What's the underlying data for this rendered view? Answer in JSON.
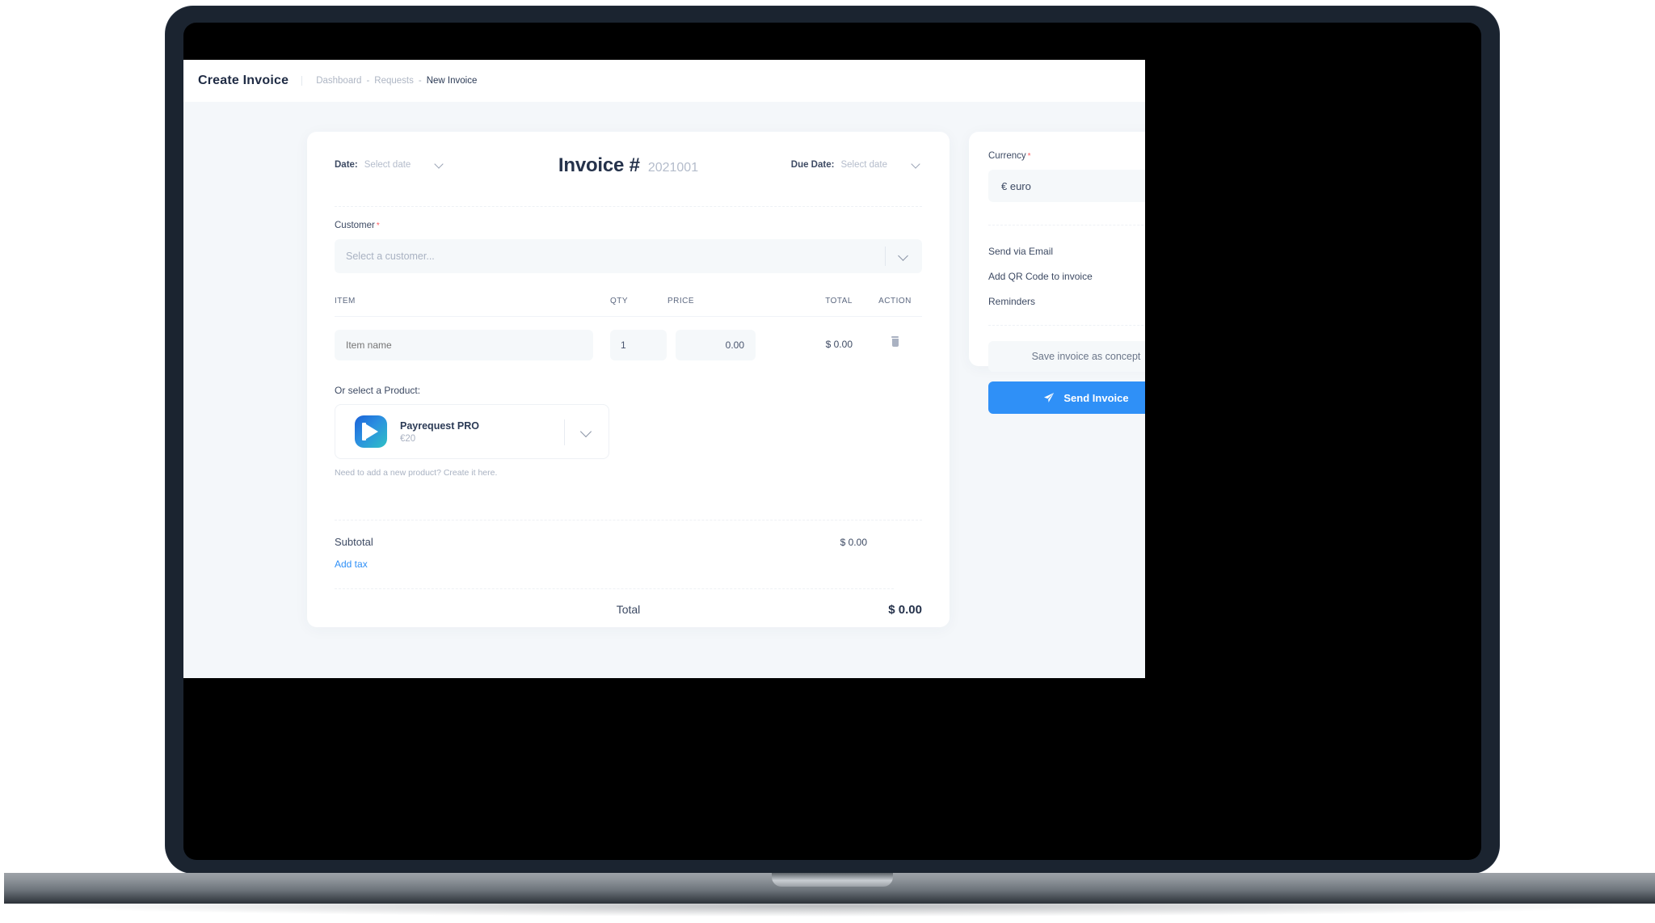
{
  "header": {
    "title": "Create Invoice",
    "breadcrumb": [
      {
        "label": "Dashboard",
        "current": false
      },
      {
        "label": "Requests",
        "current": false
      },
      {
        "label": "New Invoice",
        "current": true
      }
    ],
    "separator": "-"
  },
  "invoice": {
    "date_label": "Date:",
    "date_value": "Select date",
    "due_date_label": "Due Date:",
    "due_date_value": "Select date",
    "number_label": "Invoice #",
    "number_value": "2021001"
  },
  "customer": {
    "label": "Customer",
    "required_mark": "*",
    "placeholder": "Select a customer..."
  },
  "items": {
    "columns": [
      "ITEM",
      "QTY",
      "PRICE",
      "TOTAL",
      "ACTION"
    ],
    "rows": [
      {
        "name_placeholder": "Item name",
        "name_value": "",
        "qty": "1",
        "price": "0.00",
        "total": "$ 0.00",
        "action_icon": "trash-icon"
      }
    ]
  },
  "product": {
    "label": "Or select a Product:",
    "name": "Payrequest PRO",
    "price": "€20",
    "hint": "Need to add a new product? Create it here."
  },
  "totals": {
    "subtotal_label": "Subtotal",
    "subtotal_value": "$ 0.00",
    "add_tax_label": "Add tax",
    "total_label": "Total",
    "total_value": "$ 0.00"
  },
  "settings": {
    "currency_label": "Currency",
    "currency_required_mark": "*",
    "currency_value": "€ euro",
    "toggles": [
      {
        "label": "Send via Email",
        "on": true
      },
      {
        "label": "Add QR Code to invoice",
        "on": true
      },
      {
        "label": "Reminders",
        "on": true
      }
    ],
    "save_concept_label": "Save invoice as concept",
    "send_invoice_label": "Send Invoice"
  },
  "colors": {
    "accent_blue": "#2f90f7",
    "required_red": "#ff5a5f",
    "page_background": "#f4f7fa",
    "card_white": "#ffffff",
    "field_gray": "#f5f8fa",
    "text_dark": "#25324b",
    "text_muted": "#a9b2c2",
    "device_frame": "#1b2430"
  }
}
